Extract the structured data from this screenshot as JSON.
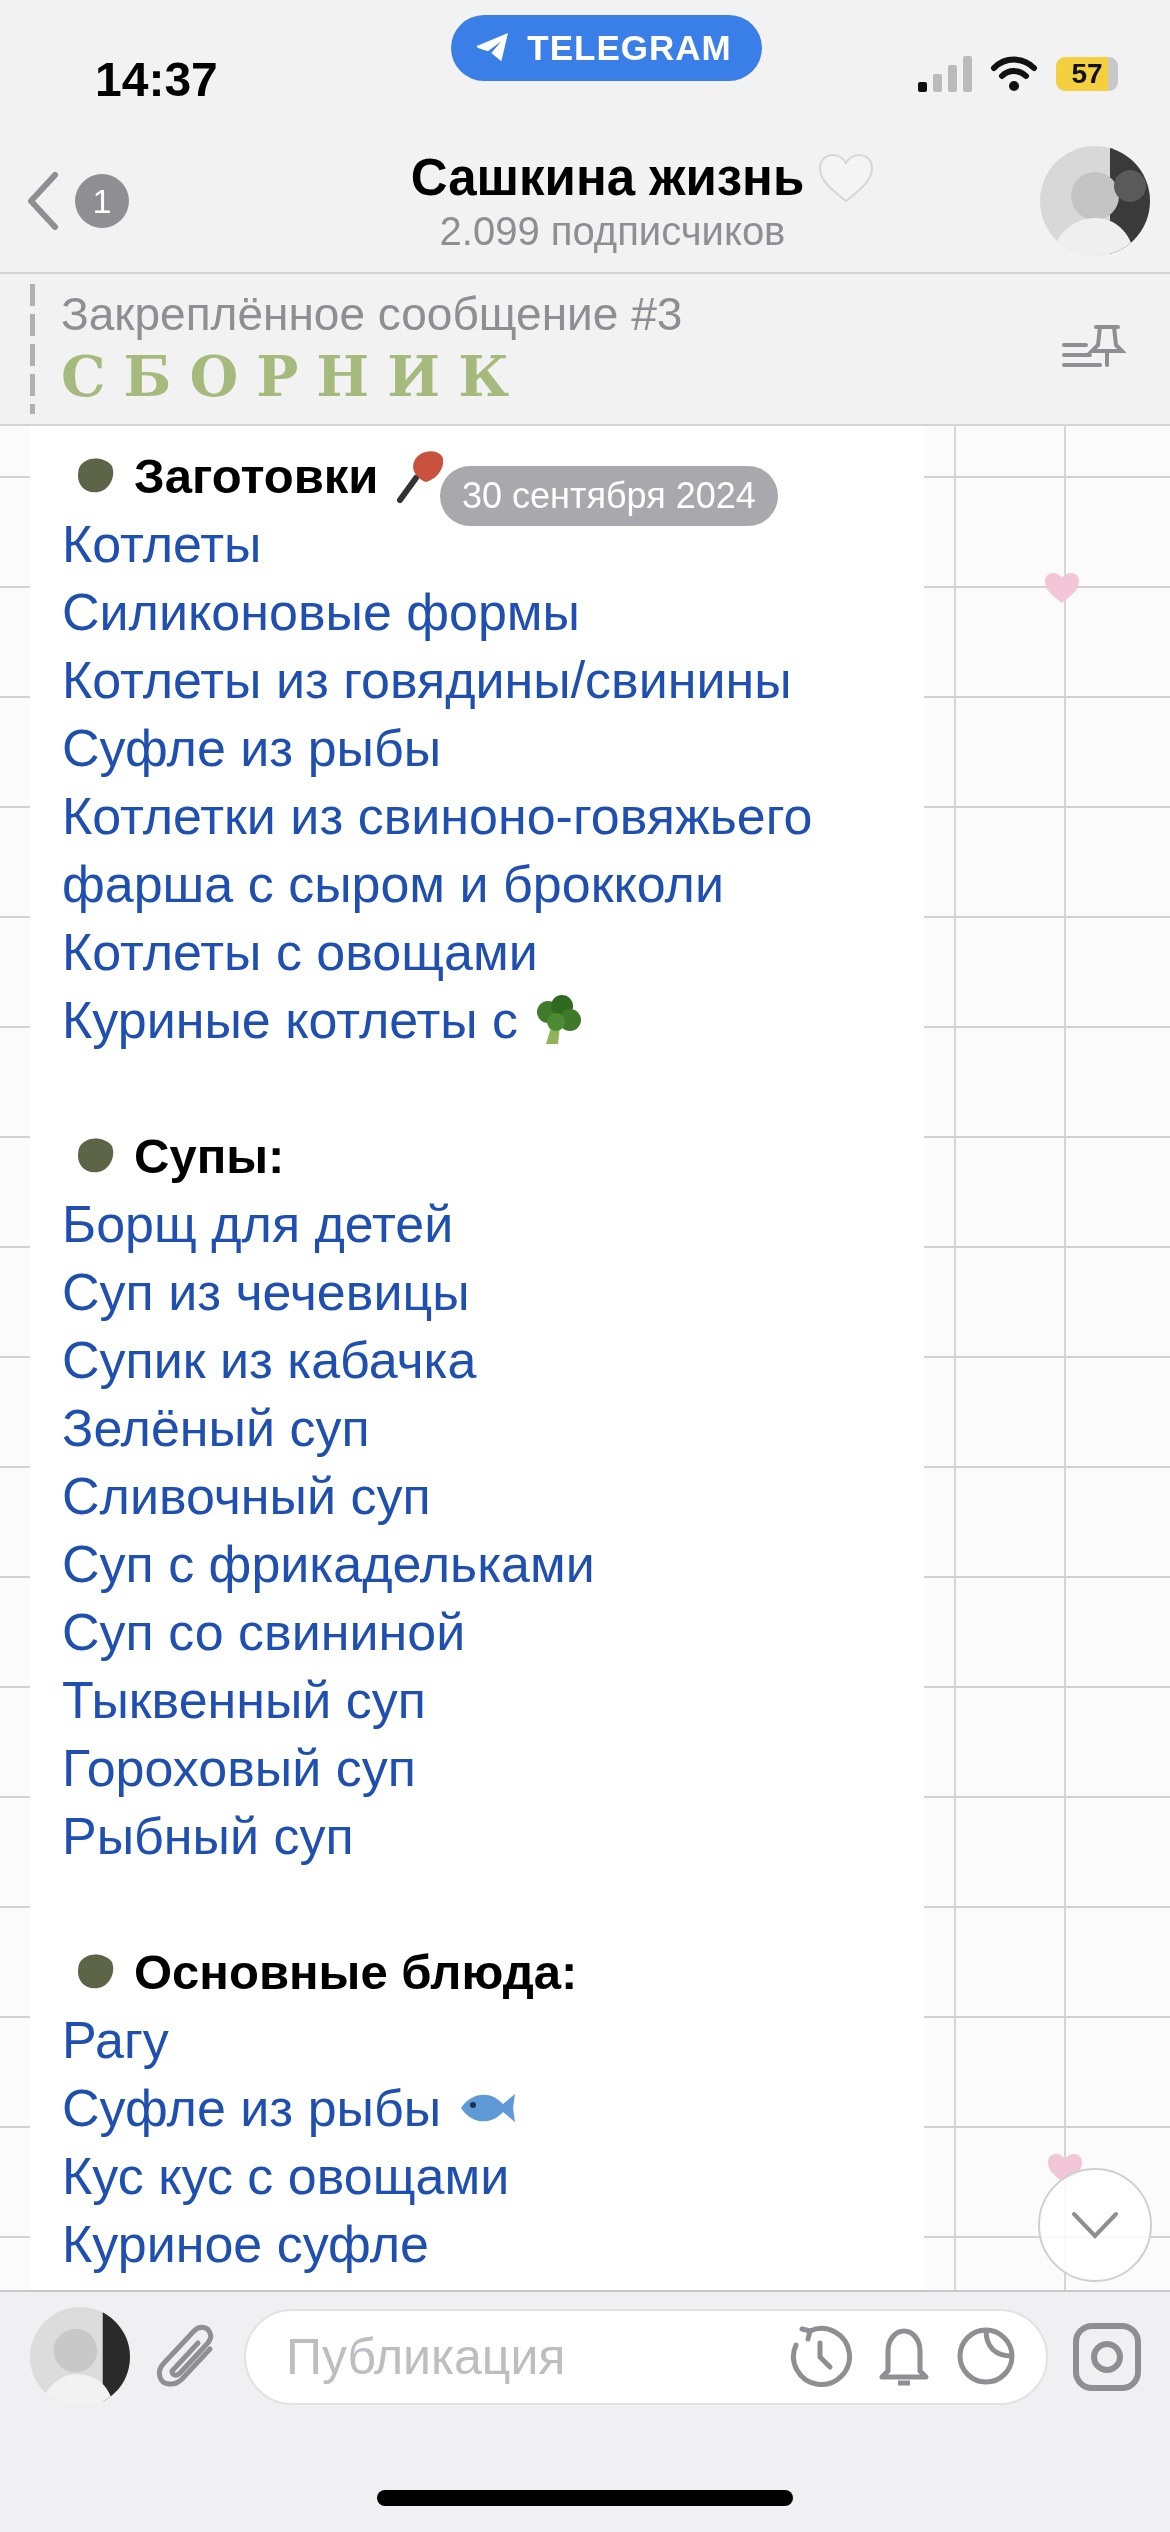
{
  "status_bar": {
    "time": "14:37",
    "app_pill": "TELEGRAM",
    "battery": "57"
  },
  "header": {
    "back_count": "1",
    "title": "Сашкина жизнь",
    "subtitle": "2.099 подписчиков"
  },
  "pinned": {
    "label": "Закреплённое сообщение #3",
    "text": "СБОРНИК"
  },
  "date_badge": "30 сентября 2024",
  "sections": [
    {
      "heading": "Заготовки",
      "emoji": true,
      "items": [
        {
          "text": "Котлеты"
        },
        {
          "text": "Силиконовые формы"
        },
        {
          "text": "Котлеты из говядины/свинины"
        },
        {
          "text": "Суфле из рыбы"
        },
        {
          "text": "Котлетки из свиноно-говяжьего фарша с сыром и брокколи"
        },
        {
          "text": "Котлеты с овощами"
        },
        {
          "text": "Куриные котлеты с",
          "emoji": true
        }
      ]
    },
    {
      "heading": "Супы:",
      "items": [
        {
          "text": "Борщ для детей"
        },
        {
          "text": "Суп из чечевицы"
        },
        {
          "text": "Супик из кабачка"
        },
        {
          "text": "Зелёный суп"
        },
        {
          "text": "Сливочный суп"
        },
        {
          "text": "Суп с фрикадельками"
        },
        {
          "text": "Суп со свининой"
        },
        {
          "text": "Тыквенный суп"
        },
        {
          "text": "Гороховый суп"
        },
        {
          "text": "Рыбный суп"
        }
      ]
    },
    {
      "heading": "Основные блюда:",
      "items": [
        {
          "text": "Рагу"
        },
        {
          "text": "Суфле из рыбы",
          "emoji": true
        },
        {
          "text": "Кус кус с овощами"
        },
        {
          "text": "Куриное суфле"
        }
      ]
    }
  ],
  "composer": {
    "placeholder": "Публикация"
  }
}
